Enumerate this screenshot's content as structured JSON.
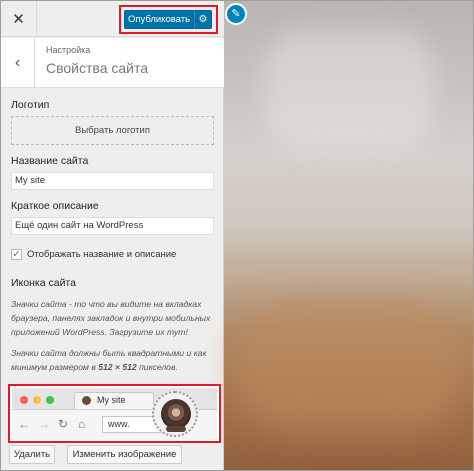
{
  "header": {
    "close_icon": "close-icon",
    "publish_label": "Опубликовать",
    "gear_icon": "gear-icon"
  },
  "section": {
    "breadcrumb": "Настройка",
    "title": "Свойства сайта"
  },
  "logo": {
    "label": "Логотип",
    "select_button": "Выбрать логотип"
  },
  "site_name": {
    "label": "Название сайта",
    "value": "My site"
  },
  "tagline": {
    "label": "Краткое описание",
    "value": "Ещё один сайт на WordPress"
  },
  "display_checkbox": {
    "checked": true,
    "label": "Отображать название и описание"
  },
  "site_icon": {
    "label": "Иконка сайта",
    "description1": "Значки сайта - то что вы видите на вкладках браузера, панелях закладок и внутри мобильных приложений WordPress. Загрузите их тут!",
    "description2_prefix": "Значки сайта должны быть квадратными и как минимум размером в ",
    "description2_size": "512 × 512",
    "description2_suffix": " пикселов.",
    "preview_tab_title": "My site",
    "preview_url": "www.",
    "remove_button": "Удалить",
    "change_button": "Изменить изображение"
  },
  "colors": {
    "accent": "#0073aa",
    "highlight": "#e0192b"
  }
}
